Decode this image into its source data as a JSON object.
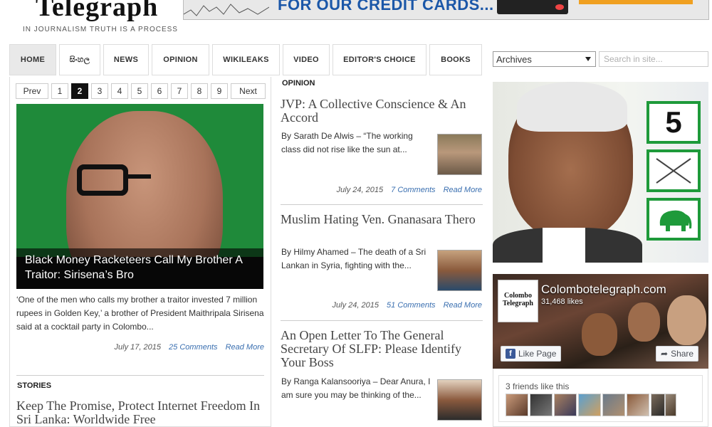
{
  "site": {
    "logo": "Telegraph",
    "tagline": "IN JOURNALISM TRUTH IS A PROCESS",
    "banner_text": "FOR OUR CREDIT CARDS..."
  },
  "nav": {
    "items": [
      {
        "label": "HOME",
        "active": true
      },
      {
        "label": "සිංහල"
      },
      {
        "label": "NEWS"
      },
      {
        "label": "OPINION"
      },
      {
        "label": "WIKILEAKS"
      },
      {
        "label": "VIDEO"
      },
      {
        "label": "EDITOR'S CHOICE"
      },
      {
        "label": "BOOKS"
      }
    ]
  },
  "sidebar_top": {
    "archives_label": "Archives",
    "search_placeholder": "Search in site..."
  },
  "pager": {
    "prev": "Prev",
    "pages": [
      "1",
      "2",
      "3",
      "4",
      "5",
      "6",
      "7",
      "8",
      "9"
    ],
    "current": "2",
    "next": "Next"
  },
  "featured": {
    "caption": "Black Money Racketeers Call My Brother A Traitor: Sirisena’s Bro",
    "excerpt": "‘One of the men who calls my brother a traitor invested 7 million rupees in Golden Key,’ a brother of President Maithripala Sirisena said at a cocktail party in Colombo...",
    "date": "July 17, 2015",
    "comments": "25 Comments",
    "read_more": "Read More"
  },
  "stories": {
    "heading": "STORIES",
    "first_title": "Keep The Promise, Protect Internet Freedom In Sri Lanka: Worldwide Free"
  },
  "opinion": {
    "heading": "OPINION",
    "articles": [
      {
        "title": "JVP: A Collective Conscience & An Accord",
        "excerpt": "By Sarath De Alwis – “The working class did not rise like the sun at...",
        "date": "July 24, 2015",
        "comments": "7 Comments",
        "read_more": "Read More"
      },
      {
        "title": "Muslim Hating Ven. Gnanasara Thero",
        "excerpt": "By Hilmy Ahamed – The death of a Sri Lankan in Syria, fighting with the...",
        "date": "July 24, 2015",
        "comments": "51 Comments",
        "read_more": "Read More"
      },
      {
        "title": "An Open Letter To The General Secretary Of SLFP: Please Identify Your Boss",
        "excerpt": "By Ranga Kalansooriya – Dear Anura, I am sure you may be thinking of the..."
      }
    ]
  },
  "poster": {
    "number": "5"
  },
  "facebook": {
    "logo_text": "Colombo Telegraph",
    "page_name": "Colombotelegraph.com",
    "likes": "31,468 likes",
    "like_button": "Like Page",
    "share_button": "Share",
    "friends_text": "3 friends like this",
    "icon": "facebook-f-icon"
  }
}
